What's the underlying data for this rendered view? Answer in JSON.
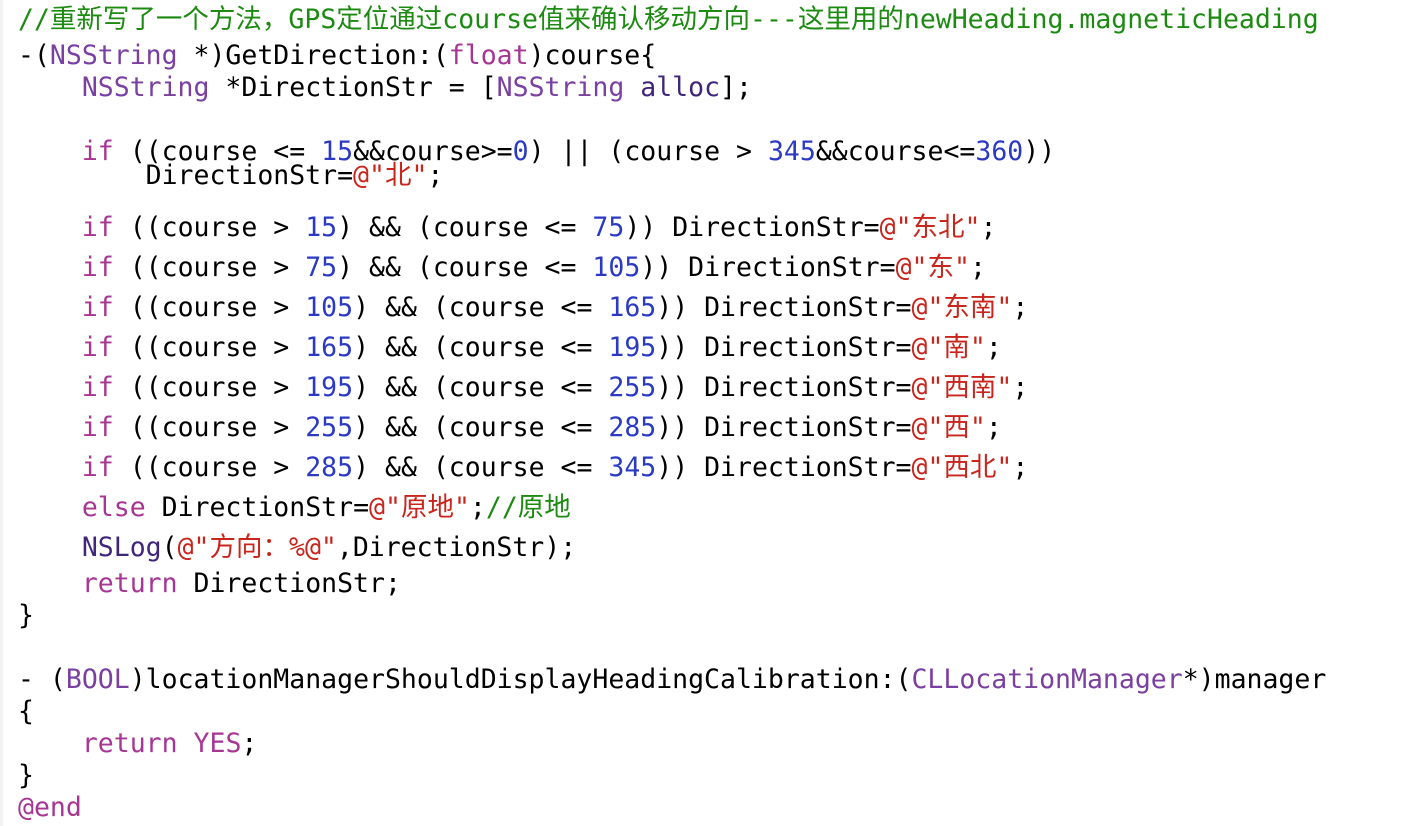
{
  "colors": {
    "plain": "#000000",
    "comment": "#1d8a12",
    "type": "#7a3fa0",
    "keyword": "#a73594",
    "number": "#2b3ac2",
    "string": "#c8251c",
    "method": "#40267a"
  },
  "lines": [
    [
      [
        "comment",
        "//重新写了一个方法，GPS定位通过course值来确认移动方向---这里用的newHeading.magneticHeading"
      ]
    ],
    [
      [
        "plain",
        "-("
      ],
      [
        "type",
        "NSString"
      ],
      [
        "plain",
        " *)GetDirection:("
      ],
      [
        "keyword",
        "float"
      ],
      [
        "plain",
        ")course{"
      ]
    ],
    [
      [
        "plain",
        "    "
      ],
      [
        "type",
        "NSString"
      ],
      [
        "plain",
        " *DirectionStr = ["
      ],
      [
        "type",
        "NSString"
      ],
      [
        "plain",
        " "
      ],
      [
        "method",
        "alloc"
      ],
      [
        "plain",
        "];"
      ]
    ],
    [
      [
        "plain",
        ""
      ]
    ],
    [
      [
        "plain",
        "    "
      ],
      [
        "keyword",
        "if"
      ],
      [
        "plain",
        " ((course <= "
      ],
      [
        "number",
        "15"
      ],
      [
        "plain",
        "&&course>="
      ],
      [
        "number",
        "0"
      ],
      [
        "plain",
        ") || (course > "
      ],
      [
        "number",
        "345"
      ],
      [
        "plain",
        "&&course<="
      ],
      [
        "number",
        "360"
      ],
      [
        "plain",
        "))"
      ]
    ],
    [
      [
        "plain",
        "        DirectionStr="
      ],
      [
        "string",
        "@\"北\""
      ],
      [
        "plain",
        ";"
      ]
    ],
    [
      [
        "plain",
        "    "
      ],
      [
        "keyword",
        "if"
      ],
      [
        "plain",
        " ((course > "
      ],
      [
        "number",
        "15"
      ],
      [
        "plain",
        ") && (course <= "
      ],
      [
        "number",
        "75"
      ],
      [
        "plain",
        ")) DirectionStr="
      ],
      [
        "string",
        "@\"东北\""
      ],
      [
        "plain",
        ";"
      ]
    ],
    [
      [
        "plain",
        "    "
      ],
      [
        "keyword",
        "if"
      ],
      [
        "plain",
        " ((course > "
      ],
      [
        "number",
        "75"
      ],
      [
        "plain",
        ") && (course <= "
      ],
      [
        "number",
        "105"
      ],
      [
        "plain",
        ")) DirectionStr="
      ],
      [
        "string",
        "@\"东\""
      ],
      [
        "plain",
        ";"
      ]
    ],
    [
      [
        "plain",
        "    "
      ],
      [
        "keyword",
        "if"
      ],
      [
        "plain",
        " ((course > "
      ],
      [
        "number",
        "105"
      ],
      [
        "plain",
        ") && (course <= "
      ],
      [
        "number",
        "165"
      ],
      [
        "plain",
        ")) DirectionStr="
      ],
      [
        "string",
        "@\"东南\""
      ],
      [
        "plain",
        ";"
      ]
    ],
    [
      [
        "plain",
        "    "
      ],
      [
        "keyword",
        "if"
      ],
      [
        "plain",
        " ((course > "
      ],
      [
        "number",
        "165"
      ],
      [
        "plain",
        ") && (course <= "
      ],
      [
        "number",
        "195"
      ],
      [
        "plain",
        ")) DirectionStr="
      ],
      [
        "string",
        "@\"南\""
      ],
      [
        "plain",
        ";"
      ]
    ],
    [
      [
        "plain",
        "    "
      ],
      [
        "keyword",
        "if"
      ],
      [
        "plain",
        " ((course > "
      ],
      [
        "number",
        "195"
      ],
      [
        "plain",
        ") && (course <= "
      ],
      [
        "number",
        "255"
      ],
      [
        "plain",
        ")) DirectionStr="
      ],
      [
        "string",
        "@\"西南\""
      ],
      [
        "plain",
        ";"
      ]
    ],
    [
      [
        "plain",
        "    "
      ],
      [
        "keyword",
        "if"
      ],
      [
        "plain",
        " ((course > "
      ],
      [
        "number",
        "255"
      ],
      [
        "plain",
        ") && (course <= "
      ],
      [
        "number",
        "285"
      ],
      [
        "plain",
        ")) DirectionStr="
      ],
      [
        "string",
        "@\"西\""
      ],
      [
        "plain",
        ";"
      ]
    ],
    [
      [
        "plain",
        "    "
      ],
      [
        "keyword",
        "if"
      ],
      [
        "plain",
        " ((course > "
      ],
      [
        "number",
        "285"
      ],
      [
        "plain",
        ") && (course <= "
      ],
      [
        "number",
        "345"
      ],
      [
        "plain",
        ")) DirectionStr="
      ],
      [
        "string",
        "@\"西北\""
      ],
      [
        "plain",
        ";"
      ]
    ],
    [
      [
        "plain",
        "    "
      ],
      [
        "keyword",
        "else"
      ],
      [
        "plain",
        " DirectionStr="
      ],
      [
        "string",
        "@\"原地\""
      ],
      [
        "plain",
        ";"
      ],
      [
        "comment",
        "//原地"
      ]
    ],
    [
      [
        "plain",
        "    "
      ],
      [
        "method",
        "NSLog"
      ],
      [
        "plain",
        "("
      ],
      [
        "string",
        "@\"方向：%@\""
      ],
      [
        "plain",
        ",DirectionStr);"
      ]
    ],
    [
      [
        "plain",
        "    "
      ],
      [
        "keyword",
        "return"
      ],
      [
        "plain",
        " DirectionStr;"
      ]
    ],
    [
      [
        "plain",
        "}"
      ]
    ],
    [
      [
        "plain",
        ""
      ]
    ],
    [
      [
        "plain",
        "- ("
      ],
      [
        "type",
        "BOOL"
      ],
      [
        "plain",
        ")locationManagerShouldDisplayHeadingCalibration:("
      ],
      [
        "type",
        "CLLocationManager"
      ],
      [
        "plain",
        "*)manager"
      ]
    ],
    [
      [
        "plain",
        "{"
      ]
    ],
    [
      [
        "plain",
        "    "
      ],
      [
        "keyword",
        "return"
      ],
      [
        "plain",
        " "
      ],
      [
        "keyword",
        "YES"
      ],
      [
        "plain",
        ";"
      ]
    ],
    [
      [
        "plain",
        "}"
      ]
    ],
    [
      [
        "keyword",
        "@end"
      ]
    ]
  ]
}
